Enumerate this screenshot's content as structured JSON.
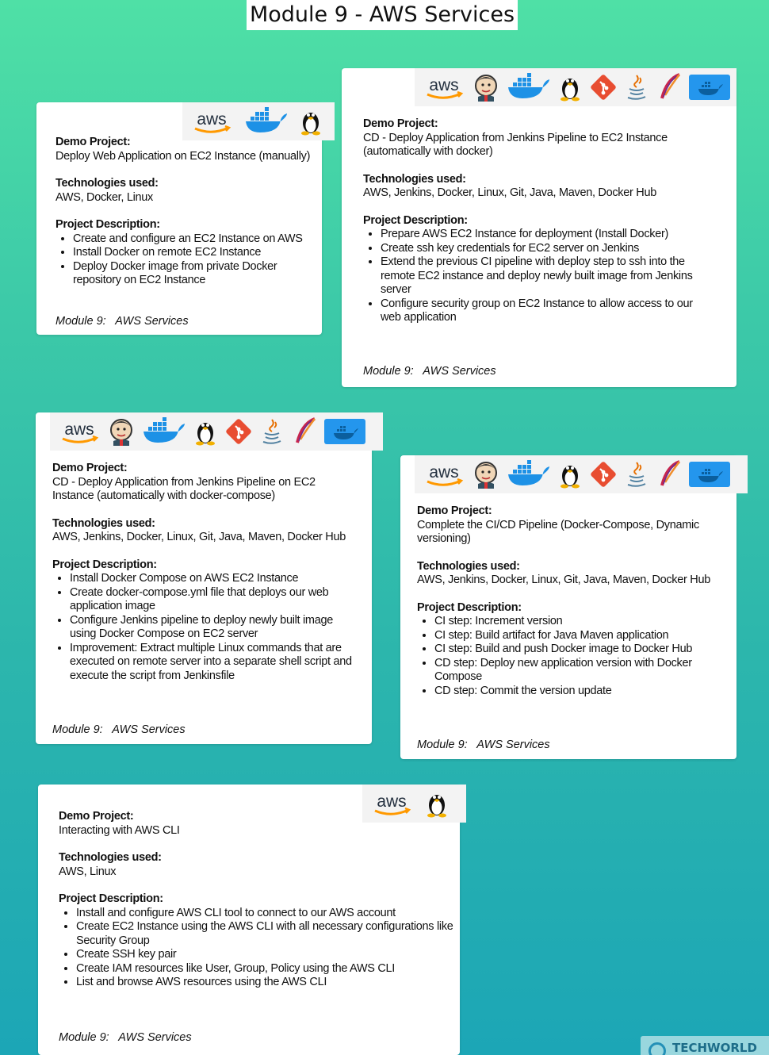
{
  "title": "Module 9 - AWS Services",
  "cards": [
    {
      "demo_heading": "Demo Project:",
      "demo_lines": [
        "Deploy Web Application on EC2 Instance (manually)"
      ],
      "tech_heading": "Technologies used:",
      "tech": "AWS, Docker, Linux",
      "desc_heading": "Project Description:",
      "items": [
        "Create and configure an EC2 Instance on AWS",
        "Install Docker on remote EC2 Instance",
        "Deploy Docker image from private Docker repository on EC2 Instance"
      ],
      "footer": "Module 9:   AWS Services",
      "logos": [
        "aws-icon",
        "docker-icon",
        "linux-tux-icon"
      ]
    },
    {
      "demo_heading": "Demo Project:",
      "demo_lines": [
        "CD - Deploy Application from Jenkins Pipeline to EC2 Instance (automatically with docker)"
      ],
      "tech_heading": "Technologies used:",
      "tech": "AWS, Jenkins, Docker, Linux, Git, Java, Maven, Docker Hub",
      "desc_heading": "Project Description:",
      "items": [
        "Prepare AWS EC2 Instance for deployment (Install Docker)",
        "Create ssh key credentials for EC2 server on Jenkins",
        "Extend the previous CI pipeline with deploy step to ssh into the remote EC2 instance and deploy newly built image from Jenkins server",
        "Configure security group on EC2 Instance to allow access to our web application"
      ],
      "footer": "Module 9:   AWS Services",
      "logos": [
        "aws-icon",
        "jenkins-icon",
        "docker-icon",
        "linux-tux-icon",
        "git-icon",
        "java-icon",
        "maven-icon",
        "docker-hub-icon"
      ]
    },
    {
      "demo_heading": "Demo Project:",
      "demo_lines": [
        "CD - Deploy Application from Jenkins Pipeline on EC2 Instance (automatically with docker-compose)"
      ],
      "tech_heading": "Technologies used:",
      "tech": "AWS, Jenkins, Docker, Linux, Git, Java, Maven, Docker Hub",
      "desc_heading": "Project Description:",
      "items": [
        "Install Docker Compose on AWS EC2 Instance",
        "Create docker-compose.yml file that deploys our web application image",
        "Configure Jenkins pipeline to deploy newly built image using Docker Compose on EC2 server",
        "Improvement: Extract multiple Linux commands that are executed on remote server into a separate shell script and execute the script from Jenkinsfile"
      ],
      "footer": "Module 9:   AWS Services",
      "logos": [
        "aws-icon",
        "jenkins-icon",
        "docker-icon",
        "linux-tux-icon",
        "git-icon",
        "java-icon",
        "maven-icon",
        "docker-hub-icon"
      ]
    },
    {
      "demo_heading": "Demo Project:",
      "demo_lines": [
        "Complete the CI/CD Pipeline (Docker-Compose, Dynamic versioning)"
      ],
      "tech_heading": "Technologies used:",
      "tech": "AWS, Jenkins, Docker, Linux, Git, Java, Maven, Docker Hub",
      "desc_heading": "Project Description:",
      "items": [
        "CI step: Increment version",
        "CI step: Build artifact for Java Maven application",
        "CI step: Build and push Docker image to Docker Hub",
        "CD step: Deploy new application version with Docker Compose",
        "CD step: Commit the version update"
      ],
      "footer": "Module 9:   AWS Services",
      "logos": [
        "aws-icon",
        "jenkins-icon",
        "docker-icon",
        "linux-tux-icon",
        "git-icon",
        "java-icon",
        "maven-icon",
        "docker-hub-icon"
      ]
    },
    {
      "demo_heading": "Demo Project:",
      "demo_lines": [
        "Interacting with AWS CLI"
      ],
      "tech_heading": "Technologies used:",
      "tech": "AWS, Linux",
      "desc_heading": "Project Description:",
      "items": [
        "Install and configure AWS CLI tool to connect to our AWS account",
        "Create EC2 Instance using the AWS CLI with all necessary configurations like Security Group",
        "Create SSH key pair",
        "Create IAM resources like User, Group, Policy using the AWS CLI",
        "List and browse AWS resources using the AWS CLI"
      ],
      "footer": "Module 9:   AWS Services",
      "logos": [
        "aws-icon",
        "linux-tux-icon"
      ]
    }
  ],
  "brand_watermark": "TECHWORLD"
}
